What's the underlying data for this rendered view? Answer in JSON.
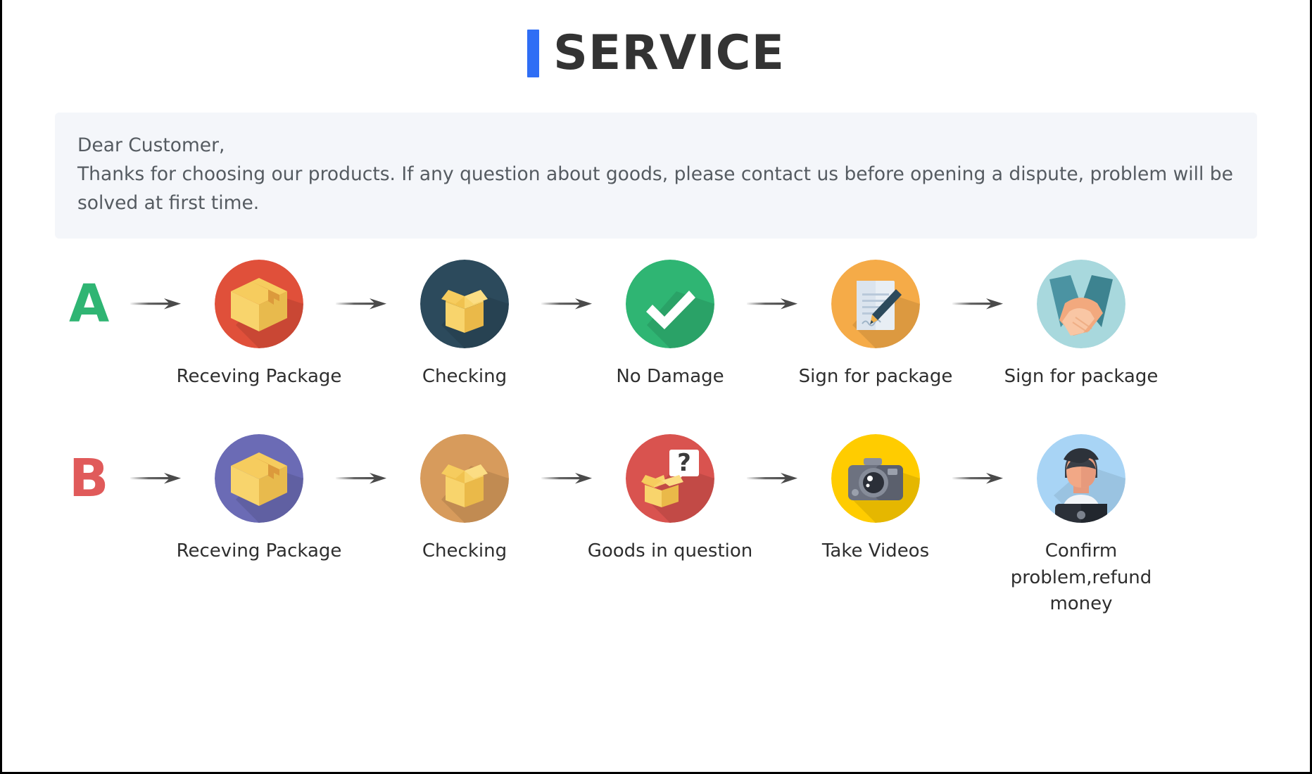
{
  "header": {
    "title": "SERVICE",
    "accent_color": "#2f6ef5"
  },
  "notice": {
    "greeting": "Dear Customer,",
    "body": "Thanks for choosing our products. If any question about goods, please contact us before opening a dispute, problem will be solved at first time.",
    "background_color": "#f4f6fa",
    "text_color": "#555b61"
  },
  "flows": [
    {
      "letter": "A",
      "letter_color": "#2fb573",
      "steps": [
        {
          "label": "Receving Package",
          "icon": "sealed-box-icon",
          "circle_color": "#e0503a"
        },
        {
          "label": "Checking",
          "icon": "open-box-icon",
          "circle_color": "#2c4a5c"
        },
        {
          "label": "No Damage",
          "icon": "check-mark-icon",
          "circle_color": "#2fb573"
        },
        {
          "label": "Sign for package",
          "icon": "document-pen-icon",
          "circle_color": "#f5ab48"
        },
        {
          "label": "Sign for package",
          "icon": "handshake-icon",
          "circle_color": "#a8d8dd"
        }
      ]
    },
    {
      "letter": "B",
      "letter_color": "#e05a5a",
      "steps": [
        {
          "label": "Receving Package",
          "icon": "sealed-box-icon",
          "circle_color": "#6b6bb5"
        },
        {
          "label": "Checking",
          "icon": "open-box-icon",
          "circle_color": "#d79b5c"
        },
        {
          "label": "Goods in question",
          "icon": "question-box-icon",
          "circle_color": "#d9534f"
        },
        {
          "label": "Take Videos",
          "icon": "camera-icon",
          "circle_color": "#ffcc00"
        },
        {
          "label": "Confirm problem,refund money",
          "icon": "support-agent-icon",
          "circle_color": "#a8d4f5"
        }
      ]
    }
  ],
  "arrow": {
    "name": "arrow-right-icon",
    "color": "#4a4a4a"
  }
}
